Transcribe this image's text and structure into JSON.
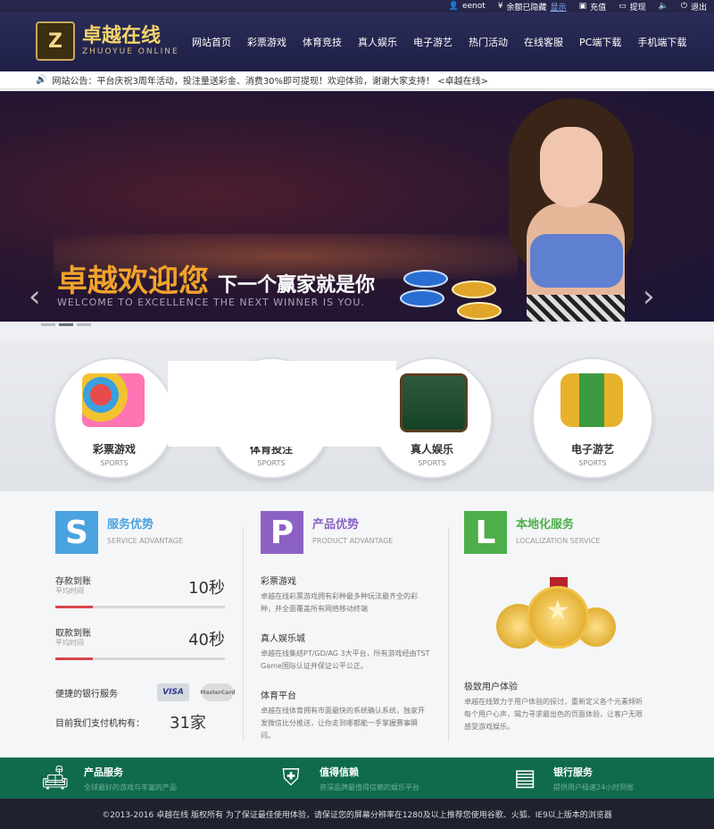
{
  "topbar": {
    "user": "eenot",
    "balance_label": "余额已隐藏",
    "balance_link": "显示",
    "recharge": "充值",
    "withdraw": "提现",
    "logout": "退出"
  },
  "logo": {
    "letter": "Z",
    "cn": "卓越在线",
    "en": "ZHUOYUE ONLINE"
  },
  "nav": [
    "网站首页",
    "彩票游戏",
    "体育竞技",
    "真人娱乐",
    "电子游艺",
    "热门活动",
    "在线客服",
    "PC端下载",
    "手机端下载"
  ],
  "notice": {
    "text": "网站公告：平台庆祝3周年活动，投注量送彩金、消费30%即可提现！欢迎体验，谢谢大家支持！ <卓越在线>"
  },
  "banner": {
    "title_orange": "卓越欢迎您",
    "title_white": "下一个赢家就是你",
    "subtitle": "WELCOME TO EXCELLENCE THE NEXT WINNER IS YOU.",
    "prev": "‹",
    "next": "›"
  },
  "categories": [
    {
      "name": "彩票游戏",
      "sub": "SPORTS",
      "icon": "bingo-icon"
    },
    {
      "name": "体育投注",
      "sub": "SPORTS",
      "icon": "sports-icon"
    },
    {
      "name": "真人娱乐",
      "sub": "SPORTS",
      "icon": "casino-table-icon"
    },
    {
      "name": "电子游艺",
      "sub": "SPORTS",
      "icon": "slot-machine-icon"
    }
  ],
  "service": {
    "badge": "S",
    "title": "服务优势",
    "sub": "SERVICE ADVANTAGE",
    "color": "#4aa3df",
    "deposit": {
      "label": "存款到账",
      "sub": "平均时间",
      "value": "10秒",
      "progress": 0.22
    },
    "withdraw": {
      "label": "取款到账",
      "sub": "平均时间",
      "value": "40秒",
      "progress": 0.22
    },
    "bank_label": "便捷的银行服务",
    "visa": "VISA",
    "mastercard": "MasterCard",
    "pay_label": "目前我们支付机构有：",
    "pay_count": "31家"
  },
  "product": {
    "badge": "P",
    "title": "产品优势",
    "sub": "PRODUCT ADVANTAGE",
    "color": "#8b62c4",
    "items": [
      {
        "h": "彩票游戏",
        "p": "卓越在线彩票游戏拥有彩种最多种玩法最齐全的彩种，并全面覆盖所有网络移动终端"
      },
      {
        "h": "真人娱乐城",
        "p": "卓越在线集结PT/GD/AG 3大平台，所有游戏经由TST Game国际认证并保证公平公正。"
      },
      {
        "h": "体育平台",
        "p": "卓越在线体育拥有市面最快的系统确认系统，独家开发微信比分推送，让你走到哪都能一手掌握赛事瞬间。"
      }
    ]
  },
  "local": {
    "badge": "L",
    "title": "本地化服务",
    "sub": "LOCALIZATION SERVICE",
    "color": "#4dae4a",
    "h": "极致用户体验",
    "p": "卓越在线致力于用户体验的探讨，重新定义各个元素倾听每个用户心声，竭力寻求最出色的页面体验，让客户无限感受游戏娱乐。"
  },
  "band": [
    {
      "title": "产品服务",
      "sub": "全球最好的游戏与丰富的产品"
    },
    {
      "title": "值得信赖",
      "sub": "资深品牌最值得信赖的娱乐平台"
    },
    {
      "title": "银行服务",
      "sub": "提供用户极速24小时到账"
    }
  ],
  "footer": {
    "text": "©2013-2016 卓越在线 版权所有 为了保证最佳使用体验，请保证您的屏幕分辨率在1280及以上推荐您使用谷歌、火狐、IE9以上版本的浏览器"
  }
}
